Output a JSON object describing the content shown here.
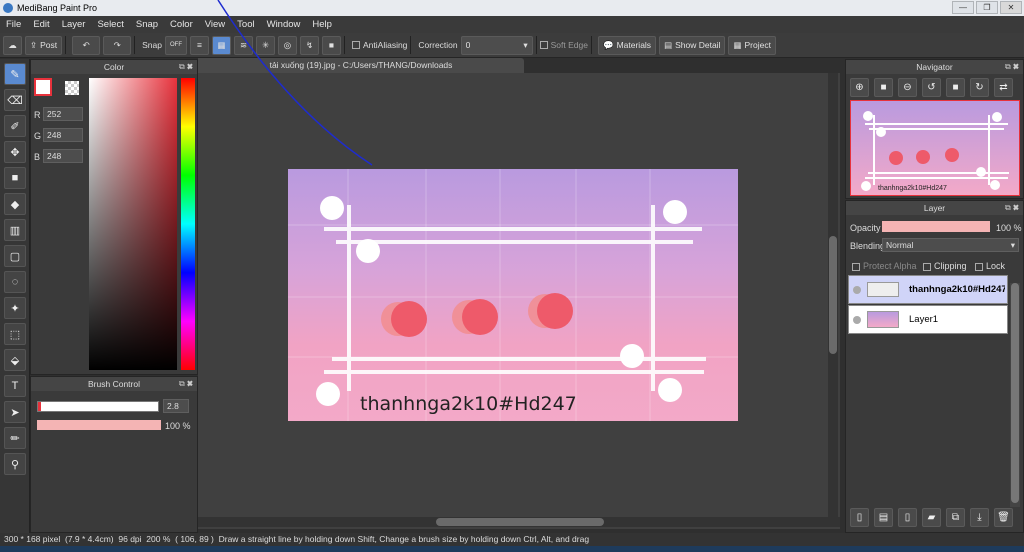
{
  "app_title": "MediBang Paint Pro",
  "menu": [
    "File",
    "Edit",
    "Layer",
    "Select",
    "Snap",
    "Color",
    "View",
    "Tool",
    "Window",
    "Help"
  ],
  "toolbar": {
    "post": "Post",
    "snap": "Snap",
    "snap_off": "OFF",
    "antialiasing": "AntiAliasing",
    "correction": "Correction",
    "correction_value": "0",
    "soft_edge": "Soft Edge",
    "materials": "Materials",
    "show_detail": "Show Detail",
    "project": "Project"
  },
  "color_panel": {
    "title": "Color",
    "r_label": "R",
    "r": "252",
    "g_label": "G",
    "g": "248",
    "b_label": "B",
    "b": "248"
  },
  "brush_control": {
    "title": "Brush Control",
    "size": "2.8",
    "opacity": "100 %"
  },
  "document_tab": "tải xuống (19).jpg - C:/Users/THANG/Downloads",
  "canvas_text": "thanhnga2k10#Hd247",
  "navigator": {
    "title": "Navigator"
  },
  "layer_panel": {
    "title": "Layer",
    "opacity_label": "Opacity",
    "opacity_value": "100 %",
    "blending_label": "Blending",
    "blending_value": "Normal",
    "protect_alpha": "Protect Alpha",
    "clipping": "Clipping",
    "lock": "Lock",
    "layers": [
      {
        "name": "thanhnga2k10#Hd247",
        "selected": true
      },
      {
        "name": "Layer1",
        "selected": false
      }
    ]
  },
  "status": {
    "size": "300 * 168 pixel",
    "cm": "(7.9 * 4.4cm)",
    "dpi": "96 dpi",
    "zoom": "200 %",
    "coords": "( 106, 89 )",
    "hint": "Draw a straight line by holding down Shift, Change a brush size by holding down Ctrl, Alt, and drag"
  },
  "colors": {
    "accent_red": "#e8323c",
    "sky_top": "#b99adf",
    "sky_bottom": "#f3a9c8",
    "dot_red": "#ee5a6a"
  }
}
